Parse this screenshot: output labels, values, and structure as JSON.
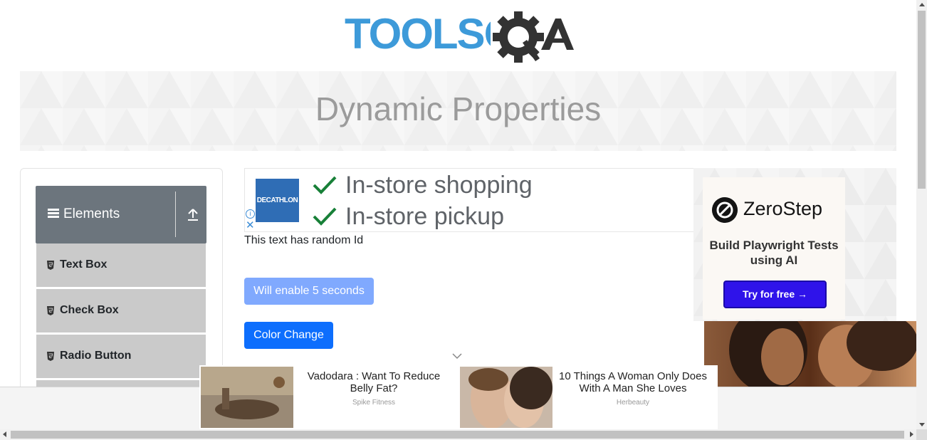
{
  "header": {
    "logo_text": "TOOLSQA"
  },
  "banner": {
    "title": "Dynamic Properties"
  },
  "sidebar": {
    "group_label": "Elements",
    "items": [
      {
        "label": "Text Box"
      },
      {
        "label": "Check Box"
      },
      {
        "label": "Radio Button"
      }
    ]
  },
  "ad_top": {
    "brand": "DECATHLON",
    "lines": [
      "In-store shopping",
      "In-store pickup"
    ],
    "close_symbol": "✕",
    "info_symbol": "i"
  },
  "main": {
    "random_text": "This text has random Id",
    "enable_button_label": "Will enable 5 seconds",
    "color_button_label": "Color Change"
  },
  "ad_right": {
    "brand": "ZeroStep",
    "tagline": "Build Playwright Tests using AI",
    "cta": "Try for free →"
  },
  "bottom_ad": {
    "stories": [
      {
        "headline": "Vadodara : Want To Reduce Belly Fat?",
        "source": "Spike Fitness"
      },
      {
        "headline": "10 Things A Woman Only Does With A Man She Loves",
        "source": "Herbeauty"
      }
    ]
  },
  "colors": {
    "primary": "#0d6efd",
    "primary_disabled": "#80a9fe",
    "sidebar_header": "#6c757d",
    "sidebar_item": "#cacaca",
    "logo_blue": "#3d9ad9",
    "logo_dark": "#333333",
    "zerostep_button": "#2f13ea"
  }
}
